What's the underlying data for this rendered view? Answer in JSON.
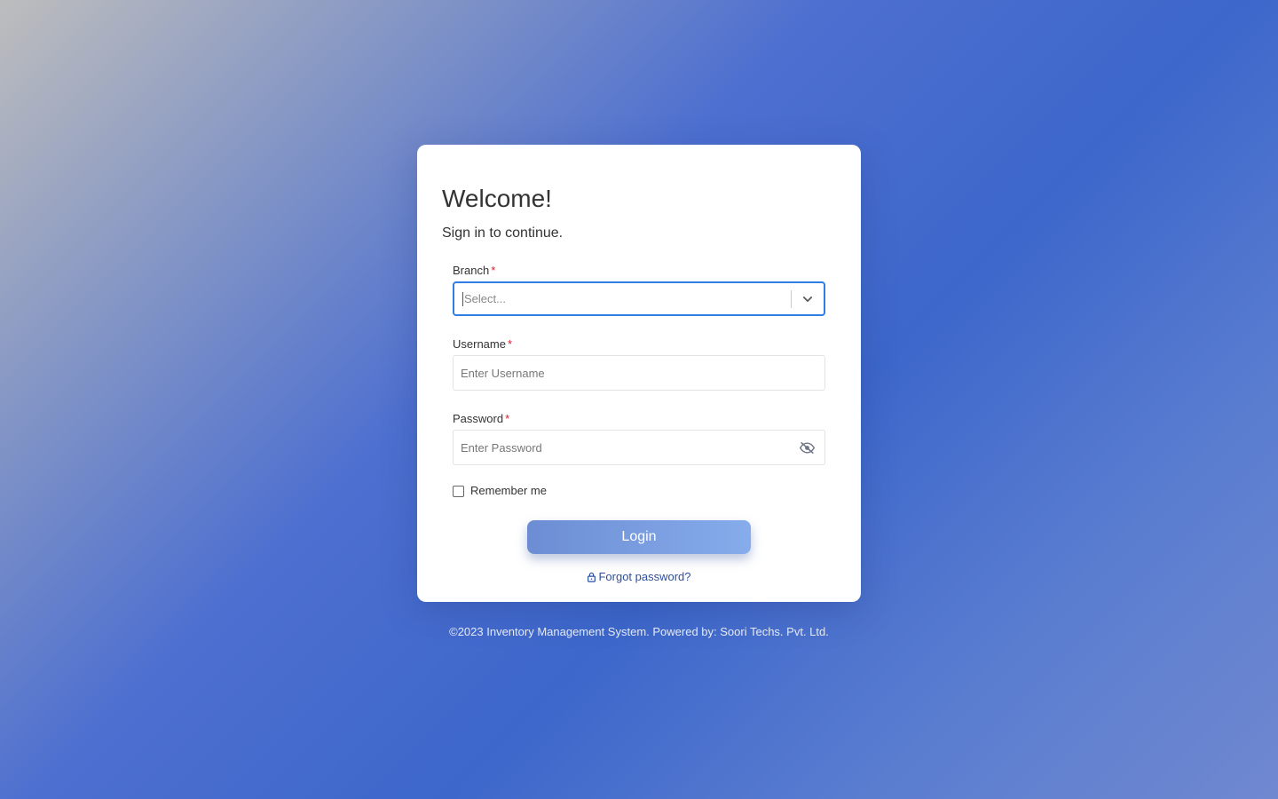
{
  "login": {
    "title": "Welcome!",
    "subtitle": "Sign in to continue.",
    "branch": {
      "label": "Branch",
      "required_mark": "*",
      "placeholder": "Select..."
    },
    "username": {
      "label": "Username",
      "required_mark": "*",
      "placeholder": "Enter Username"
    },
    "password": {
      "label": "Password",
      "required_mark": "*",
      "placeholder": "Enter Password",
      "toggle_icon": "eye-slash-icon"
    },
    "remember_label": "Remember me",
    "remember_checked": false,
    "login_button": "Login",
    "forgot_link": "Forgot password?",
    "forgot_icon": "lock-icon"
  },
  "footer": {
    "text": "©2023 Inventory Management System. Powered by: Soori Techs. Pvt. Ltd."
  },
  "colors": {
    "accent_border": "#2f7ee6",
    "required": "#e0192b",
    "link": "#2d4f9e",
    "button_start": "#6c8dd3",
    "button_end": "#86acec"
  }
}
